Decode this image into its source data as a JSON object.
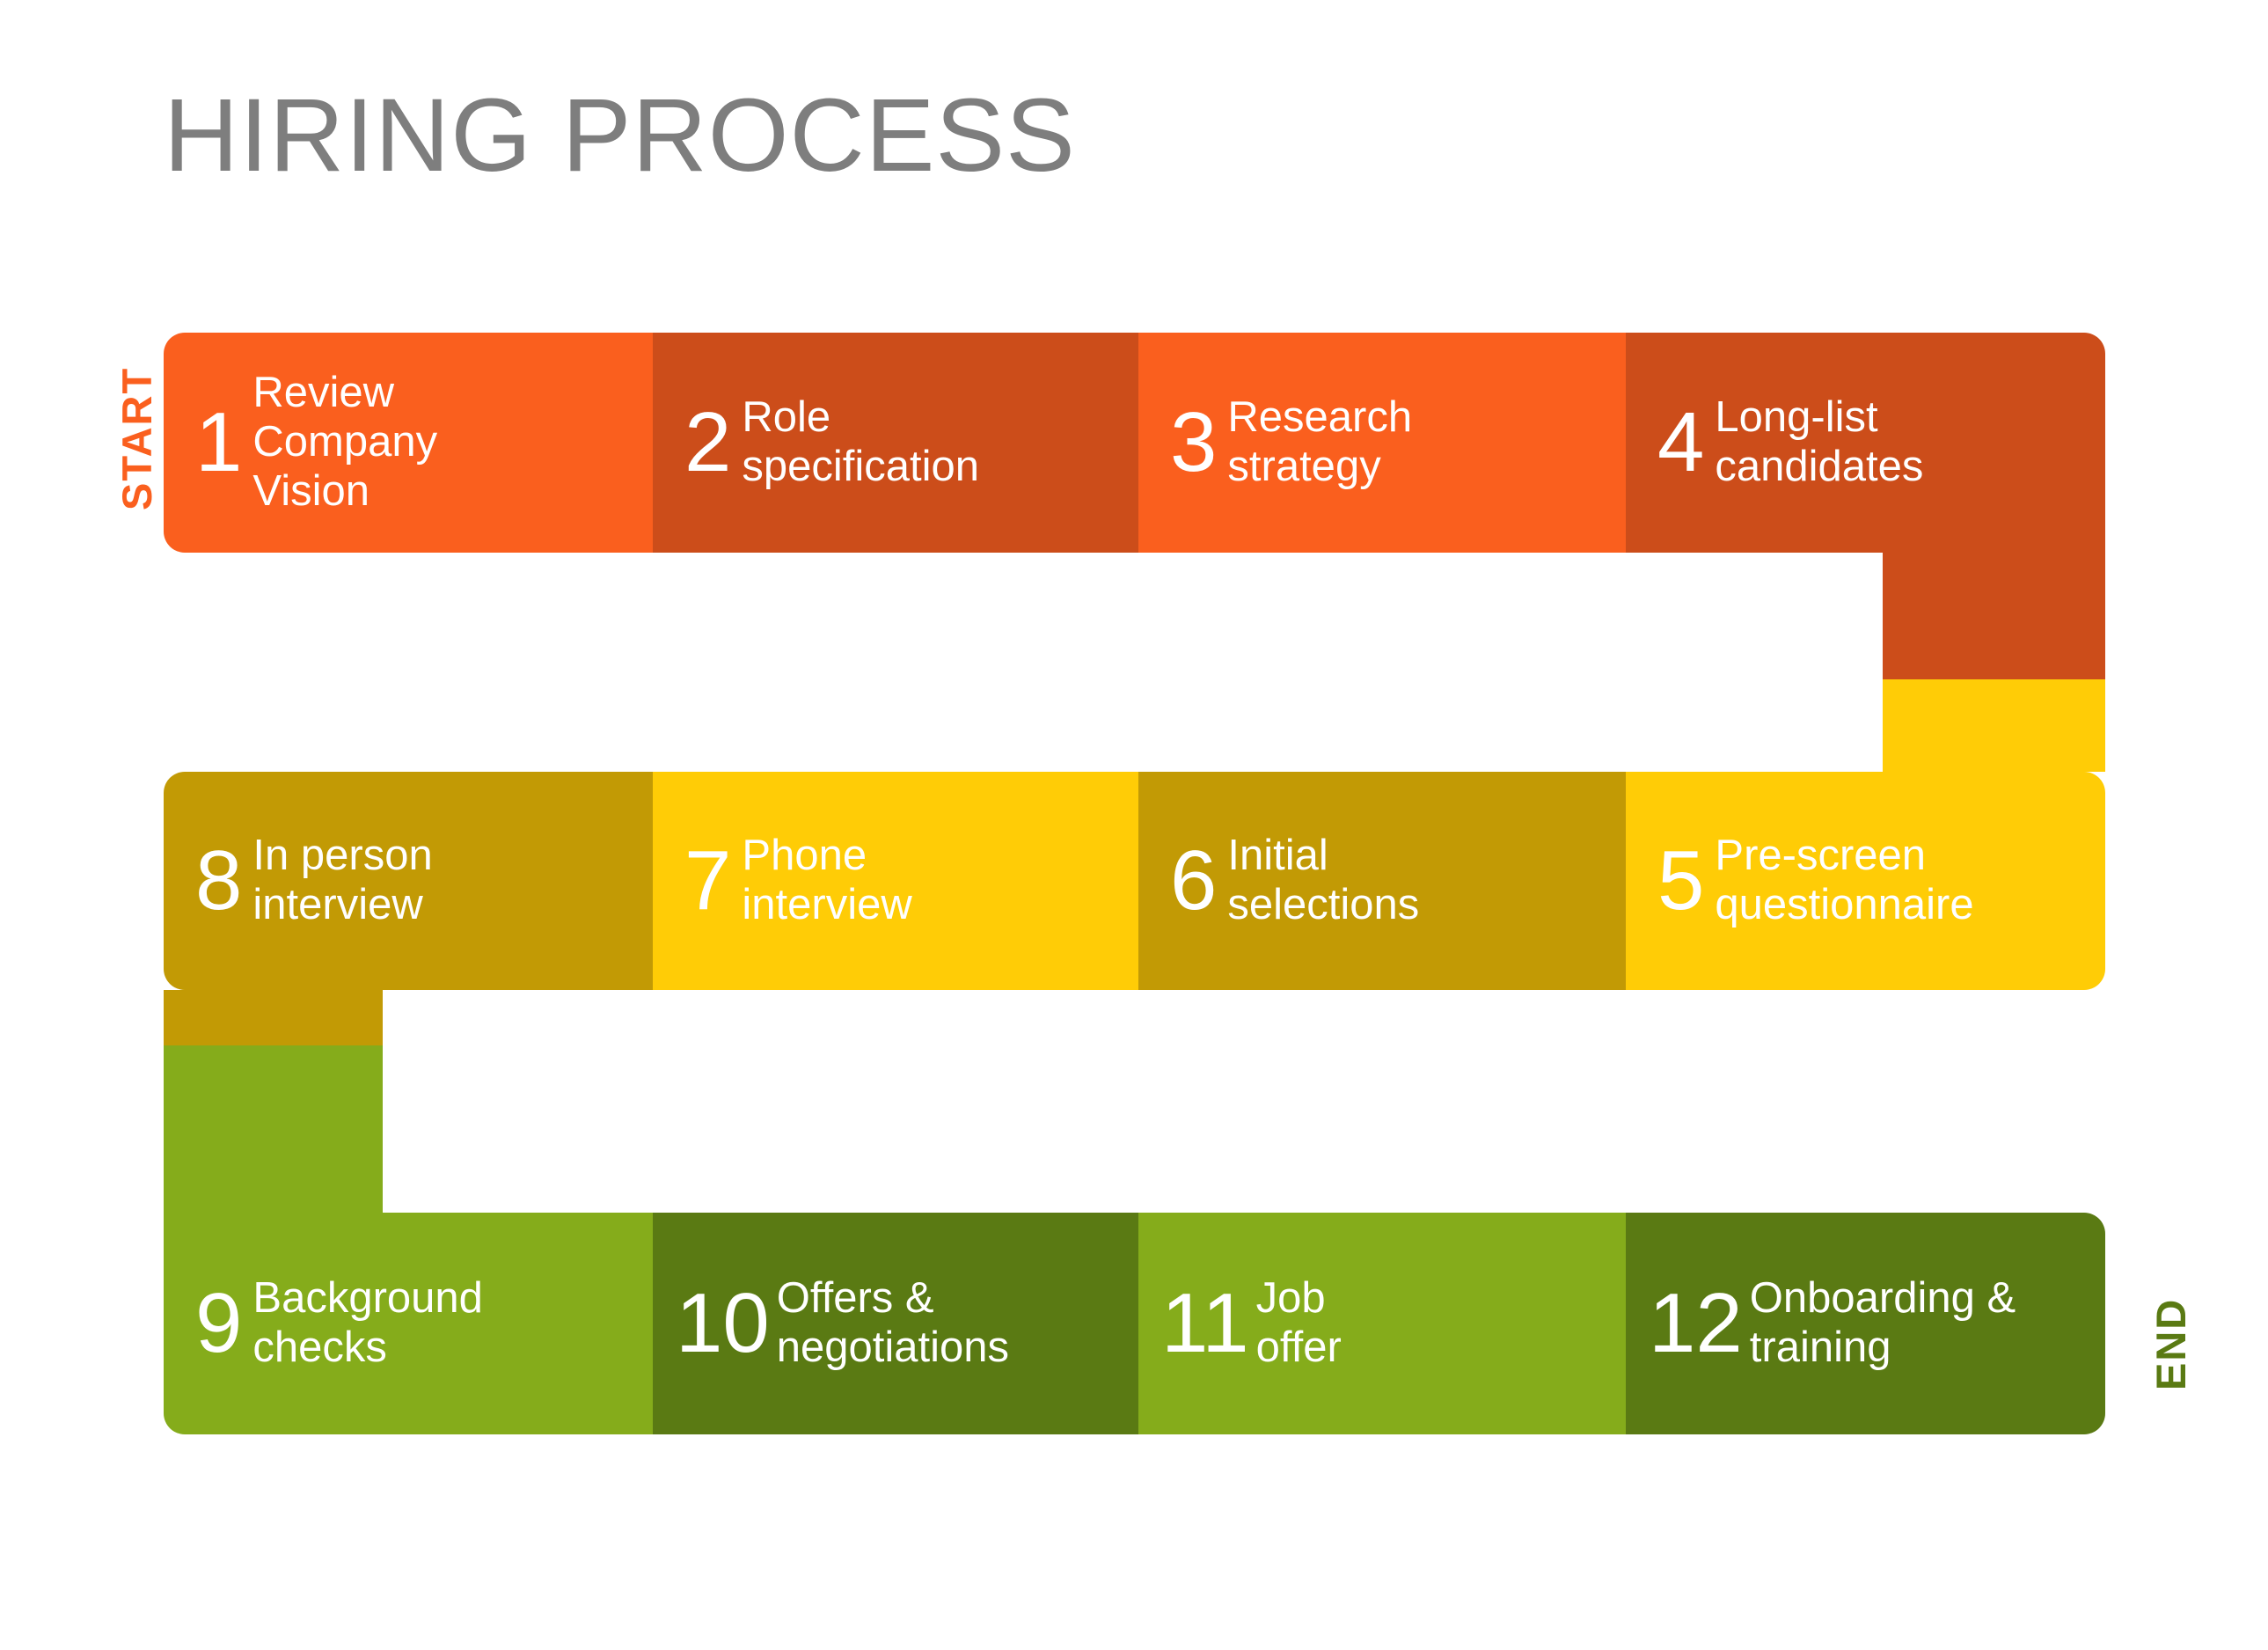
{
  "title": "HIRING PROCESS",
  "labels": {
    "start": "START",
    "end": "END"
  },
  "colors": {
    "title": "#7e7e7e",
    "orange_bright": "#fa5f1e",
    "orange_dark": "#cc4d1a",
    "yellow_bright": "#ffcc06",
    "yellow_dark": "#c29a05",
    "green_light": "#85ac1b",
    "green_dark": "#5a7a13",
    "background": "#ffffff",
    "step_text": "#ffffff"
  },
  "chart_data": {
    "type": "diagram",
    "title": "HIRING PROCESS",
    "layout": "serpentine-3-rows-4-columns",
    "start_label": "START",
    "end_label": "END",
    "steps": [
      {
        "number": "1",
        "label": "Review\nCompany\nVision",
        "color": "#fa5f1e",
        "row": 1,
        "col": 1
      },
      {
        "number": "2",
        "label": "Role\nspecification",
        "color": "#cc4d1a",
        "row": 1,
        "col": 2
      },
      {
        "number": "3",
        "label": "Research\nstrategy",
        "color": "#fa5f1e",
        "row": 1,
        "col": 3
      },
      {
        "number": "4",
        "label": "Long-list\ncandidates",
        "color": "#cc4d1a",
        "row": 1,
        "col": 4
      },
      {
        "number": "5",
        "label": "Pre-screen\nquestionnaire",
        "color": "#ffcc06",
        "row": 2,
        "col": 4
      },
      {
        "number": "6",
        "label": "Initial\nselections",
        "color": "#c29a05",
        "row": 2,
        "col": 3
      },
      {
        "number": "7",
        "label": "Phone\ninterview",
        "color": "#ffcc06",
        "row": 2,
        "col": 2
      },
      {
        "number": "8",
        "label": "In person\ninterview",
        "color": "#c29a05",
        "row": 2,
        "col": 1
      },
      {
        "number": "9",
        "label": "Background\nchecks",
        "color": "#85ac1b",
        "row": 3,
        "col": 1
      },
      {
        "number": "10",
        "label": "Offers &\nnegotiations",
        "color": "#5a7a13",
        "row": 3,
        "col": 2
      },
      {
        "number": "11",
        "label": "Job\noffer",
        "color": "#85ac1b",
        "row": 3,
        "col": 3
      },
      {
        "number": "12",
        "label": "Onboarding &\ntraining",
        "color": "#5a7a13",
        "row": 3,
        "col": 4
      }
    ],
    "connectors": [
      {
        "from": "4",
        "to": "5",
        "side": "right",
        "colors": [
          "#cc4d1a",
          "#ffcc06"
        ]
      },
      {
        "from": "8",
        "to": "9",
        "side": "left",
        "colors": [
          "#c29a05",
          "#85ac1b"
        ]
      }
    ]
  }
}
